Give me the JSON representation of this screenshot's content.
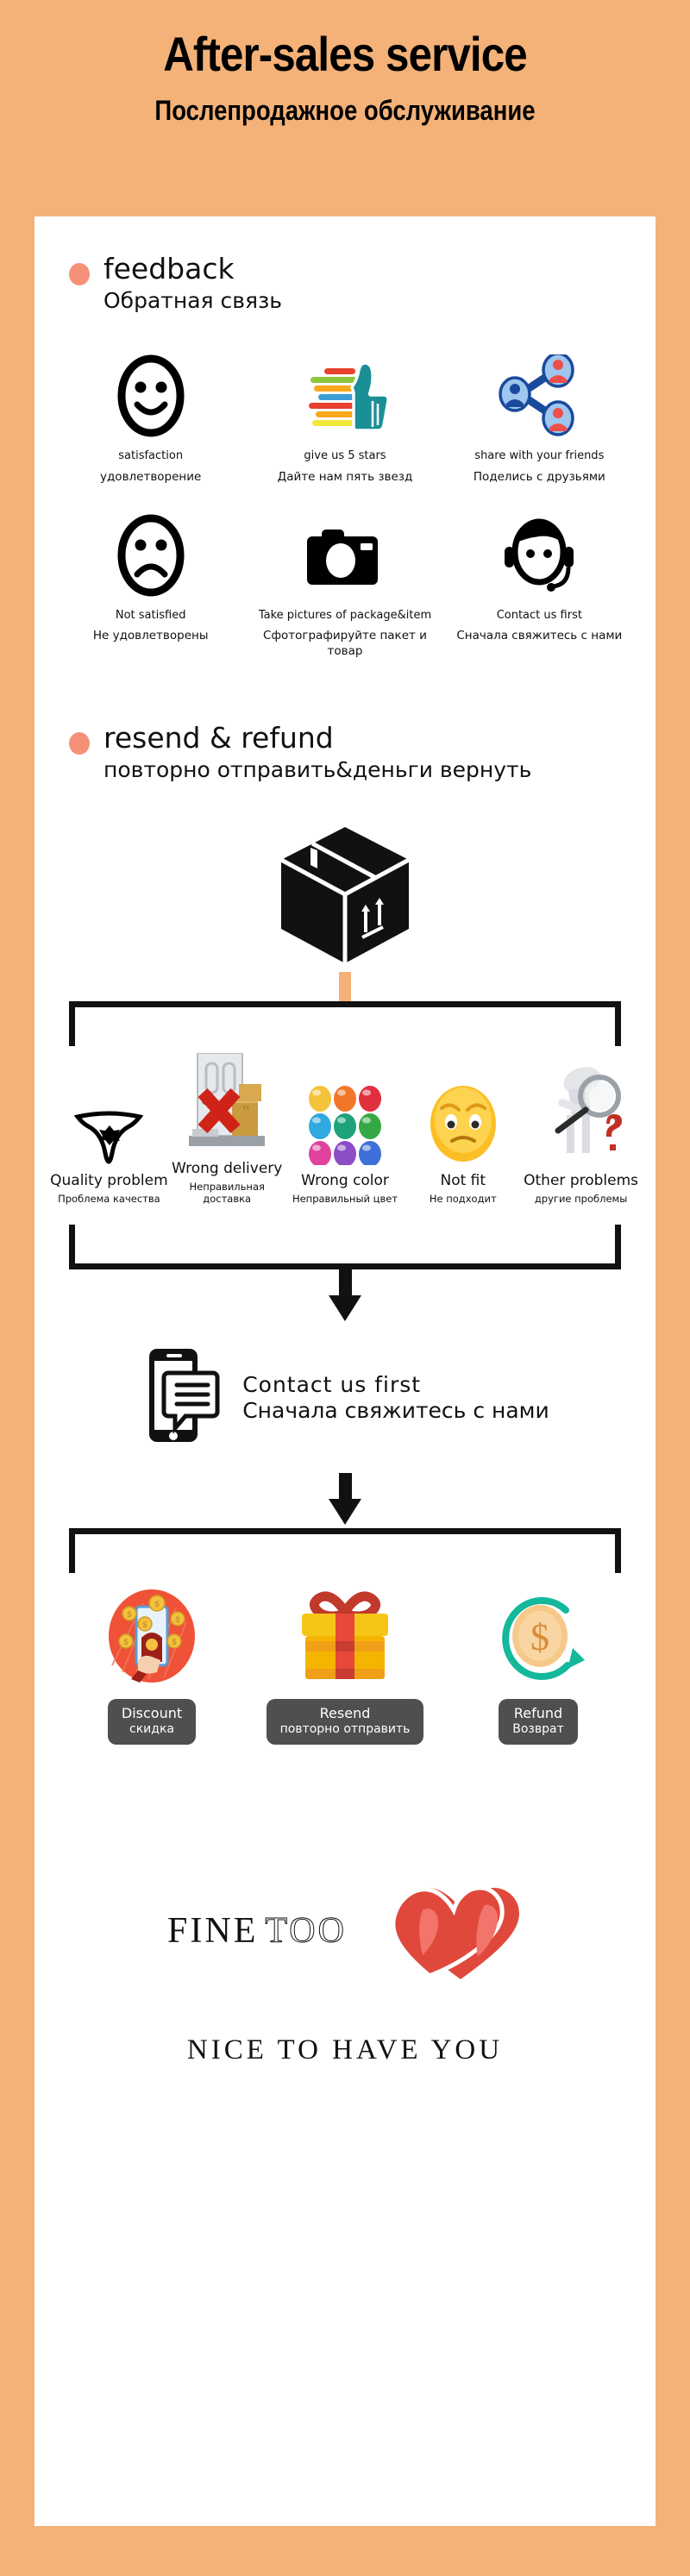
{
  "theme": {
    "background": "#f4b278",
    "card": "#ffffff",
    "bullet": "#f59178",
    "button": "#4f4f4f",
    "ink": "#111111"
  },
  "header": {
    "title_en": "After-sales service",
    "title_ru": "Послепродажное обслуживание"
  },
  "feedback_section": {
    "title_en": "feedback",
    "title_ru": "Обратная связь",
    "items": [
      {
        "icon": "smiley-face-icon",
        "en": "satisfaction",
        "ru": "удовлетворение"
      },
      {
        "icon": "thumbs-up-icon",
        "en": "give us 5 stars",
        "ru": "Дайте нам пять звезд"
      },
      {
        "icon": "share-nodes-icon",
        "en": "share with your friends",
        "ru": "Поделись с друзьями"
      },
      {
        "icon": "sad-face-icon",
        "en": "Not satisfied",
        "ru": "Не удовлетворены"
      },
      {
        "icon": "camera-icon",
        "en": "Take pictures of package&item",
        "ru": "Сфотографируйте пакет и товар"
      },
      {
        "icon": "headset-agent-icon",
        "en": "Contact us first",
        "ru": "Сначала свяжитесь с нами"
      }
    ]
  },
  "refund_section": {
    "title_en": "resend & refund",
    "title_ru": "повторно отправить&деньги вернуть",
    "package_icon": "shipping-box-icon",
    "problems": [
      {
        "icon": "panties-garment-icon",
        "en": "Quality problem",
        "ru": "Проблема качества"
      },
      {
        "icon": "wrong-delivery-icon",
        "en": "Wrong delivery",
        "ru": "Неправильная доставка"
      },
      {
        "icon": "color-swatches-icon",
        "en": "Wrong color",
        "ru": "Неправильный цвет"
      },
      {
        "icon": "worried-emoji-icon",
        "en": "Not fit",
        "ru": "Не подходит"
      },
      {
        "icon": "magnifier-person-icon",
        "en": "Other problems",
        "ru": "другие проблемы"
      }
    ],
    "contact": {
      "icon": "phone-message-icon",
      "en": "Contact us first",
      "ru": "Сначала свяжитесь с нами"
    },
    "solutions": [
      {
        "icon": "red-envelope-coins-icon",
        "en": "Discount",
        "ru": "скидка"
      },
      {
        "icon": "gift-box-icon",
        "en": "Resend",
        "ru": "повторно отправить"
      },
      {
        "icon": "coin-refund-icon",
        "en": "Refund",
        "ru": "Возврат"
      }
    ]
  },
  "footer": {
    "brand_part1": "FINE",
    "brand_part2": "TOO",
    "hearts_icon": "double-hearts-icon",
    "tagline": "NICE TO HAVE YOU"
  }
}
